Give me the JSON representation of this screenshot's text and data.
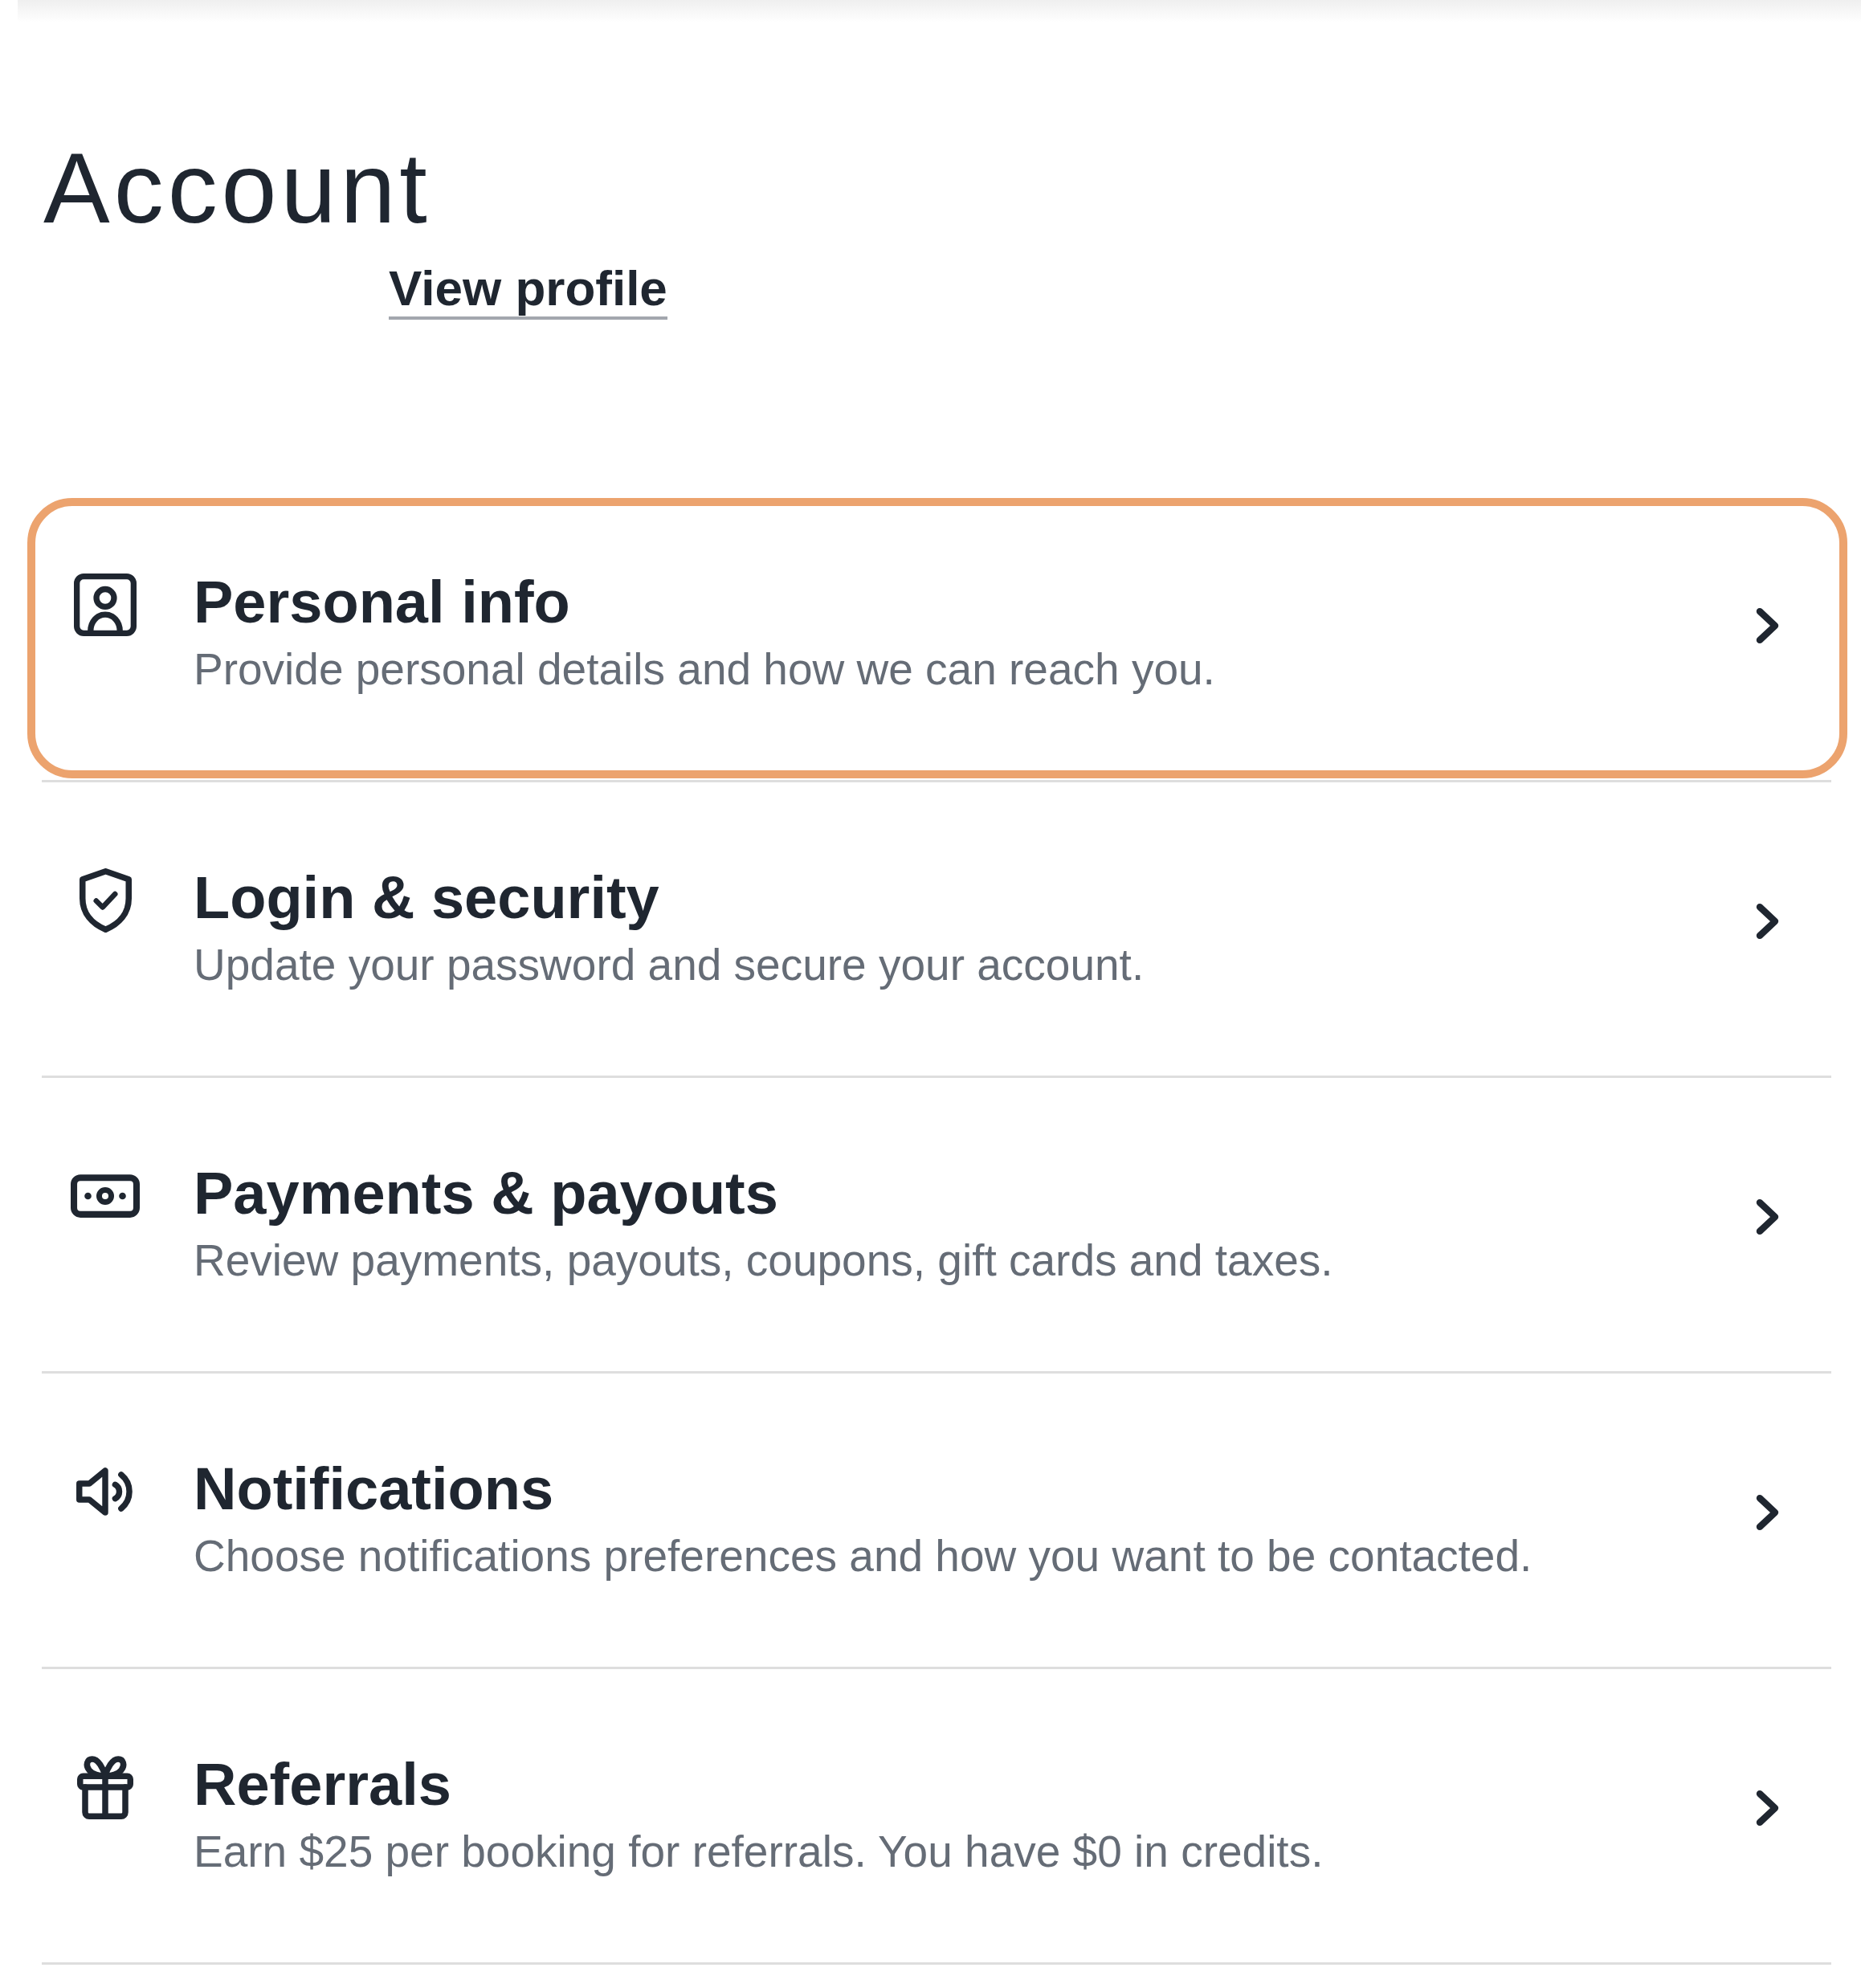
{
  "page": {
    "title": "Account",
    "profile_link": "View profile"
  },
  "settings": [
    {
      "title": "Personal info",
      "description": "Provide personal details and how we can reach you.",
      "highlighted": true
    },
    {
      "title": "Login & security",
      "description": "Update your password and secure your account.",
      "highlighted": false
    },
    {
      "title": "Payments & payouts",
      "description": "Review payments, payouts, coupons, gift cards and taxes.",
      "highlighted": false
    },
    {
      "title": "Notifications",
      "description": "Choose notifications preferences and how you want to be contacted.",
      "highlighted": false
    },
    {
      "title": "Referrals",
      "description": "Earn $25 per booking for referrals. You have $0 in credits.",
      "highlighted": false
    }
  ]
}
